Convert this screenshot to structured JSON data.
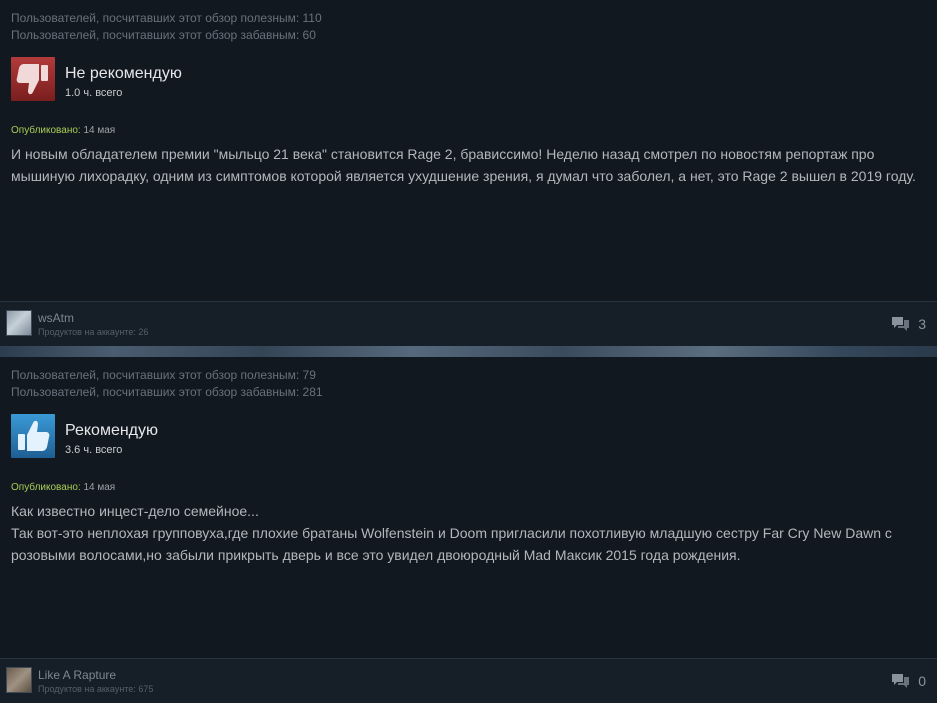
{
  "reviews": [
    {
      "helpful_line": "Пользователей, посчитавших этот обзор полезным: 110",
      "funny_line": "Пользователей, посчитавших этот обзор забавным: 60",
      "verdict": "Не рекомендую",
      "verdict_icon": "thumbs-down-icon",
      "hours": "1.0 ч. всего",
      "posted_label": "Опубликовано:",
      "posted_date": "14 мая",
      "body_lines": [
        "И новым обладателем премии \"мыльцо 21 века\" становится Rage 2, брависсимо! Неделю назад смотрел по новостям репортаж про мышиную лихорадку, одним из симптомов которой является ухудшение зрения, я думал что заболел, а нет, это Rage 2 вышел в 2019 году."
      ],
      "author": "wsAtm",
      "products": "Продуктов на аккаунте: 26",
      "comment_count": "3"
    },
    {
      "helpful_line": "Пользователей, посчитавших этот обзор полезным: 79",
      "funny_line": "Пользователей, посчитавших этот обзор забавным: 281",
      "verdict": "Рекомендую",
      "verdict_icon": "thumbs-up-icon",
      "hours": "3.6 ч. всего",
      "posted_label": "Опубликовано:",
      "posted_date": "14 мая",
      "body_lines": [
        "Как известно инцест-дело семейное...",
        "Так вот-это неплохая групповуха,где плохие братаны Wolfenstein и Doom пригласили похотливую младшую сестру Far Cry New Dawn с розовыми волосами,но забыли прикрыть дверь и все это увидел двоюродный Mad Максик 2015 года рождения."
      ],
      "author": "Like A Rapture",
      "products": "Продуктов на аккаунте: 675",
      "comment_count": "0"
    }
  ],
  "colors": {
    "background": "#121820",
    "thumbs_down": "#b23b3b",
    "thumbs_up": "#3a9ad6",
    "posted_label": "#a9cd56"
  }
}
